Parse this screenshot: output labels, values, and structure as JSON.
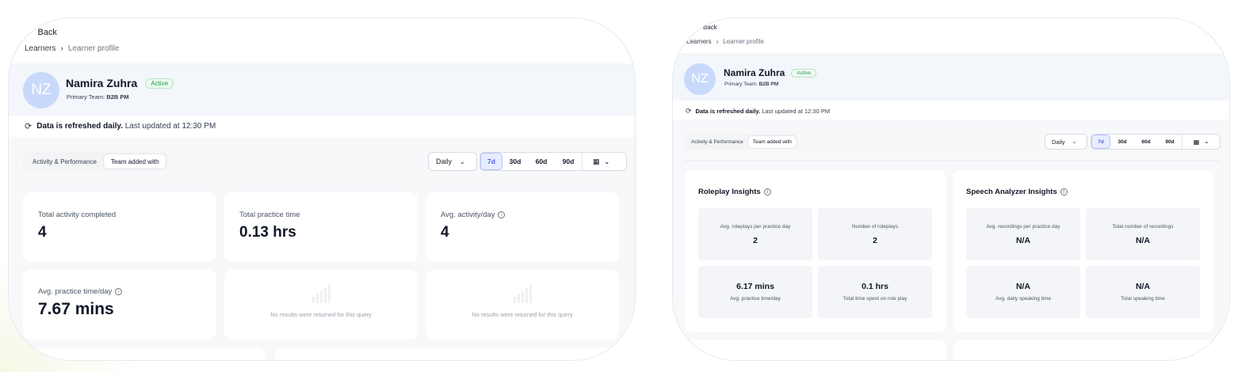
{
  "left": {
    "back_label": "Back",
    "breadcrumb": {
      "root": "Learners",
      "current": "Learner profile"
    },
    "profile": {
      "initials": "NZ",
      "name": "Namira Zuhra",
      "status": "Active",
      "team_label": "Primary Team:",
      "team_value": "B2B PM"
    },
    "refresh": {
      "bold": "Data is refreshed daily.",
      "rest": "Last updated at 12:30 PM"
    },
    "tabs": [
      "Activity & Performance",
      "Team added with"
    ],
    "granularity": "Daily",
    "ranges": [
      "7d",
      "30d",
      "60d",
      "90d"
    ],
    "stats": [
      {
        "label": "Total activity completed",
        "value": "4"
      },
      {
        "label": "Total practice time",
        "value": "0.13 hrs"
      },
      {
        "label": "Avg. activity/day",
        "value": "4"
      },
      {
        "label": "Avg. practice time/day",
        "value": "7.67 mins"
      }
    ],
    "empty_text": "No results were returned for this query"
  },
  "right": {
    "back_label": "Back",
    "breadcrumb": {
      "root": "Learners",
      "current": "Learner profile"
    },
    "profile": {
      "initials": "NZ",
      "name": "Namira Zuhra",
      "status": "Active",
      "team_label": "Primary Team:",
      "team_value": "B2B PM"
    },
    "refresh": {
      "bold": "Data is refreshed daily.",
      "rest": "Last updated at 12:30 PM"
    },
    "tabs": [
      "Activity & Performance",
      "Team added with"
    ],
    "granularity": "Daily",
    "ranges": [
      "7d",
      "30d",
      "60d",
      "90d"
    ],
    "roleplay": {
      "title": "Roleplay Insights",
      "tiles": [
        {
          "label": "Avg. roleplays per practice day",
          "value": "2"
        },
        {
          "label": "Number of roleplays",
          "value": "2"
        },
        {
          "label": "Avg. practice time/day",
          "value": "6.17 mins"
        },
        {
          "label": "Total time spent on role play",
          "value": "0.1 hrs"
        }
      ]
    },
    "speech": {
      "title": "Speech Analyzer Insights",
      "tiles": [
        {
          "label": "Avg. recordings per practice day",
          "value": "N/A"
        },
        {
          "label": "Total number of recordings",
          "value": "N/A"
        },
        {
          "label": "Avg. daily speaking time",
          "value": "N/A"
        },
        {
          "label": "Total speaking time",
          "value": "N/A"
        }
      ]
    }
  },
  "icons": {
    "back": "arrow-left-icon",
    "chevron": "chevron-right-icon",
    "refresh": "refresh-icon",
    "calendar": "calendar-icon",
    "dropdown": "chevron-down-icon",
    "info": "info-icon",
    "empty_chart": "bar-chart-icon"
  }
}
